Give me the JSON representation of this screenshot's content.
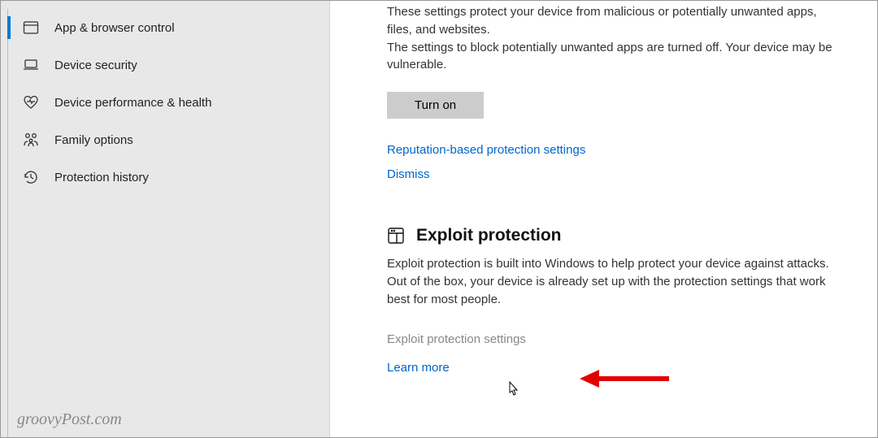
{
  "sidebar": {
    "items": [
      {
        "label": "App & browser control",
        "icon": "window-icon",
        "active": true
      },
      {
        "label": "Device security",
        "icon": "laptop-icon",
        "active": false
      },
      {
        "label": "Device performance & health",
        "icon": "heart-icon",
        "active": false
      },
      {
        "label": "Family options",
        "icon": "family-icon",
        "active": false
      },
      {
        "label": "Protection history",
        "icon": "history-icon",
        "active": false
      }
    ]
  },
  "main": {
    "reputation_desc1": "These settings protect your device from malicious or potentially unwanted apps, files, and websites.",
    "reputation_desc2": "The settings to block potentially unwanted apps are turned off. Your device may be vulnerable.",
    "turn_on_button": "Turn on",
    "reputation_settings_link": "Reputation-based protection settings",
    "dismiss_link": "Dismiss",
    "exploit_section": {
      "title": "Exploit protection",
      "desc": "Exploit protection is built into Windows to help protect your device against attacks.  Out of the box, your device is already set up with the protection settings that work best for most people.",
      "settings_link": "Exploit protection settings",
      "learn_more": "Learn more"
    }
  },
  "watermark": "groovyPost.com"
}
